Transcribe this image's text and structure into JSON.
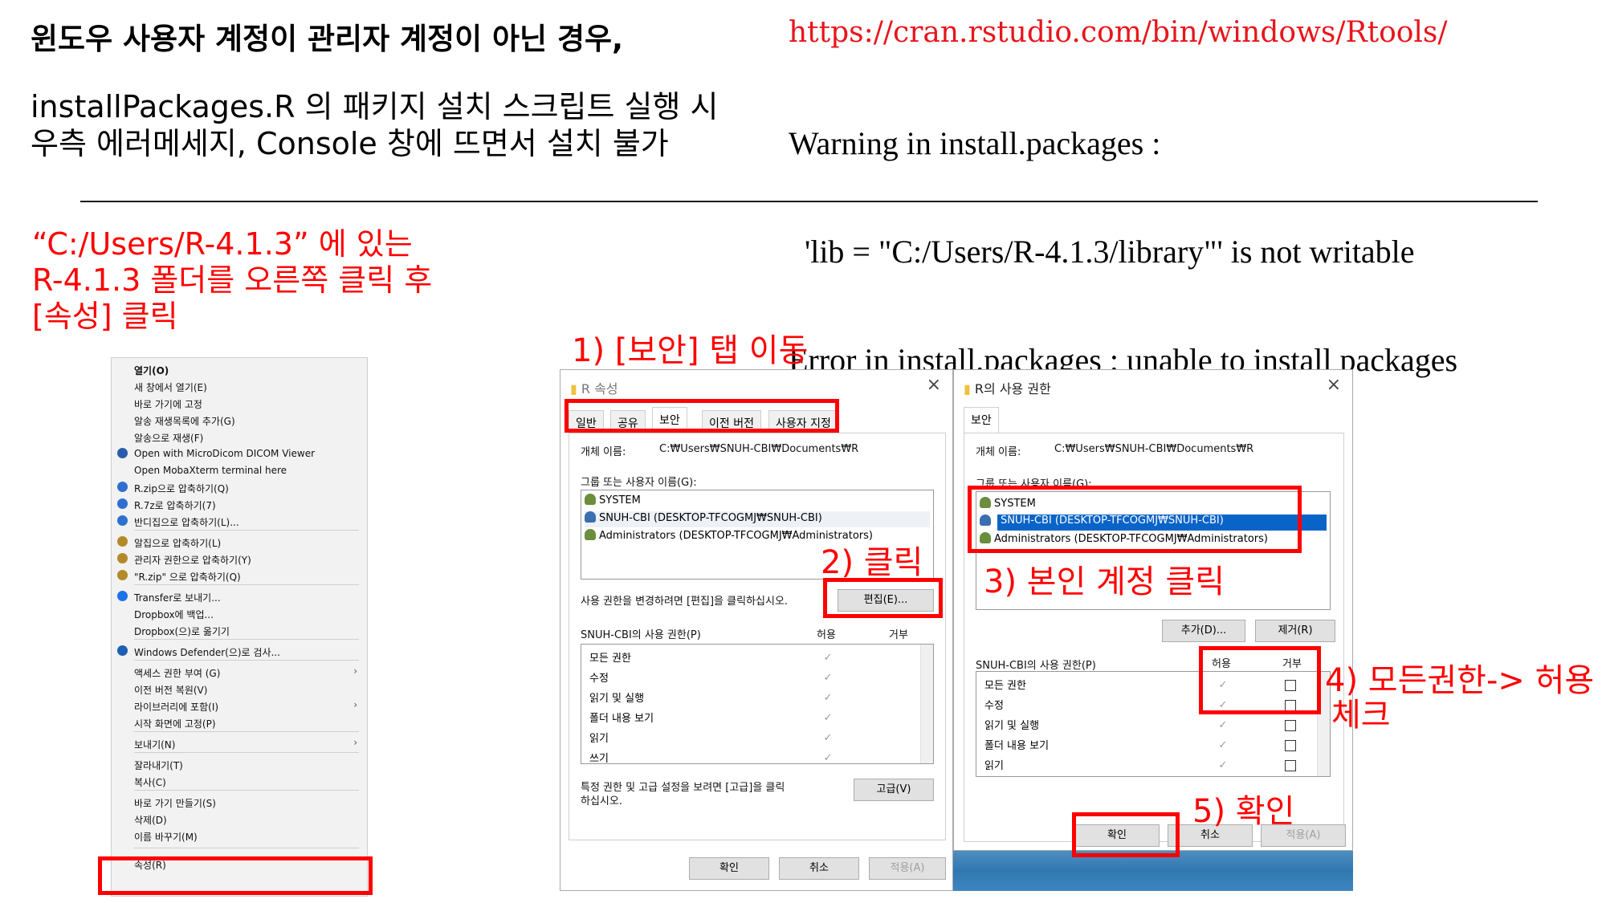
{
  "header": {
    "title": "윈도우 사용자 계정이 관리자 계정이 아닌 경우,",
    "desc_line1": "installPackages.R 의 패키지 설치 스크립트 실행 시",
    "desc_line2": "우측 에러메세지, Console 창에 뜨면서 설치 불가",
    "url": "https://cran.rstudio.com/bin/windows/Rtools/",
    "error_lines": [
      "Warning in install.packages :",
      "  'lib = \"C:/Users/R-4.1.3/library\"' is not writable",
      "Error in install.packages : unable to install packages"
    ]
  },
  "note": {
    "line1": "“C:/Users/R-4.1.3” 에 있는",
    "line2": "R-4.1.3 폴더를 오른쪽 클릭 후",
    "line3": "[속성] 클릭"
  },
  "steps": {
    "s1": "1) [보안] 탭 이동",
    "s2": "2) 클릭",
    "s3": "3) 본인 계정 클릭",
    "s4a": "4) 모든권한-> 허용",
    "s4b": "체크",
    "s5": "5) 확인"
  },
  "context_menu": {
    "items": [
      {
        "label": "열기(O)",
        "bold": true
      },
      {
        "label": "새 창에서 열기(E)"
      },
      {
        "label": "바로 가기에 고정"
      },
      {
        "label": "알송 재생목록에 추가(G)"
      },
      {
        "label": "알송으로 재생(F)"
      },
      {
        "label": "Open with MicroDicom DICOM Viewer",
        "icon": "dicom-icon"
      },
      {
        "label": "Open MobaXterm terminal here"
      },
      {
        "label": "R.zip으로 압축하기(Q)",
        "icon": "zip-icon"
      },
      {
        "label": "R.7z로 압축하기(7)",
        "icon": "zip-icon"
      },
      {
        "label": "반디집으로 압축하기(L)...",
        "icon": "zip-icon"
      },
      {
        "label": "알집으로 압축하기(L)",
        "icon": "alzip-icon"
      },
      {
        "label": "관리자 권한으로 압축하기(Y)",
        "icon": "alzip-icon"
      },
      {
        "label": "\"R.zip\" 으로 압축하기(Q)",
        "icon": "alzip-icon"
      },
      {
        "label": "Transfer로 보내기...",
        "icon": "dropbox-icon"
      },
      {
        "label": "Dropbox에 백업..."
      },
      {
        "label": "Dropbox(으)로 옮기기"
      },
      {
        "label": "Windows Defender(으)로 검사...",
        "icon": "shield-icon"
      },
      {
        "label": "액세스 권한 부여 (G)",
        "arrow": true
      },
      {
        "label": "이전 버전 복원(V)"
      },
      {
        "label": "라이브러리에 포함(I)",
        "arrow": true
      },
      {
        "label": "시작 화면에 고정(P)"
      },
      {
        "label": "보내기(N)",
        "arrow": true
      },
      {
        "label": "잘라내기(T)"
      },
      {
        "label": "복사(C)"
      },
      {
        "label": "바로 가기 만들기(S)"
      },
      {
        "label": "삭제(D)"
      },
      {
        "label": "이름 바꾸기(M)"
      },
      {
        "label": "속성(R)"
      }
    ]
  },
  "props_dialog": {
    "title": "R 속성",
    "tabs": [
      "일반",
      "공유",
      "보안",
      "이전 버전",
      "사용자 지정"
    ],
    "object_name_label": "개체 이름:",
    "object_name_value": "C:₩Users₩SNUH-CBI₩Documents₩R",
    "group_label": "그룹 또는 사용자 이름(G):",
    "users": [
      "SYSTEM",
      "SNUH-CBI (DESKTOP-TFCOGMJ₩SNUH-CBI)",
      "Administrators (DESKTOP-TFCOGMJ₩Administrators)"
    ],
    "change_hint": "사용 권한을 변경하려면 [편집]을 클릭하십시오.",
    "edit_button": "편집(E)...",
    "perm_label": "SNUH-CBI의 사용 권한(P)",
    "allow": "허용",
    "deny": "거부",
    "perms": [
      "모든 권한",
      "수정",
      "읽기 및 실행",
      "폴더 내용 보기",
      "읽기",
      "쓰기"
    ],
    "advanced_hint_1": "특정 권한 및 고급 설정을 보려면 [고급]을 클릭",
    "advanced_hint_2": "하십시오.",
    "advanced_button": "고급(V)",
    "ok": "확인",
    "cancel": "취소",
    "apply": "적용(A)"
  },
  "perm_dialog": {
    "title": "R의 사용 권한",
    "tab": "보안",
    "object_name_label": "개체 이름:",
    "object_name_value": "C:₩Users₩SNUH-CBI₩Documents₩R",
    "group_label": "그룹 또는 사용자 이름(G):",
    "users": [
      "SYSTEM",
      "SNUH-CBI (DESKTOP-TFCOGMJ₩SNUH-CBI)",
      "Administrators (DESKTOP-TFCOGMJ₩Administrators)"
    ],
    "add_button": "추가(D)...",
    "remove_button": "제거(R)",
    "perm_label": "SNUH-CBI의 사용 권한(P)",
    "allow": "허용",
    "deny": "거부",
    "perms": [
      "모든 권한",
      "수정",
      "읽기 및 실행",
      "폴더 내용 보기",
      "읽기"
    ],
    "ok": "확인",
    "cancel": "취소",
    "apply": "적용(A)"
  },
  "colors": {
    "accent_red": "#ff0000",
    "selection_blue": "#0a64c8"
  }
}
